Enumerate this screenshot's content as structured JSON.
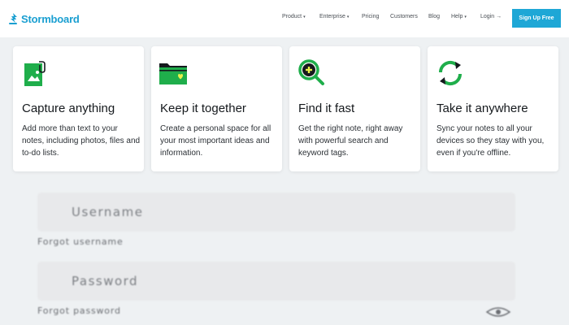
{
  "brand": {
    "name": "Stormboard",
    "color": "#1a9fd1",
    "logo_icon": "stormboard-logo-icon"
  },
  "nav": {
    "items": [
      {
        "label": "Product",
        "caret": "▾"
      },
      {
        "label": "Enterprise",
        "caret": "▾"
      },
      {
        "label": "Pricing",
        "caret": ""
      },
      {
        "label": "Customers",
        "caret": ""
      },
      {
        "label": "Blog",
        "caret": ""
      },
      {
        "label": "Help",
        "caret": "▾"
      },
      {
        "label": "Login",
        "caret": "→"
      }
    ],
    "signup_label": "Sign Up Free",
    "signup_color": "#1ea7d6"
  },
  "features": [
    {
      "icon": "image-attachment-icon",
      "title": "Capture anything",
      "description": "Add more than text to your notes, including photos, files and to-do lists."
    },
    {
      "icon": "folder-heart-icon",
      "title": "Keep it together",
      "description": "Create a personal space for all your most important ideas and information."
    },
    {
      "icon": "search-plus-icon",
      "title": "Find it fast",
      "description": "Get the right note, right away with powerful search and keyword tags."
    },
    {
      "icon": "sync-icon",
      "title": "Take it anywhere",
      "description": "Sync your notes to all your devices so they stay with you, even if you're offline."
    }
  ],
  "accent_green": "#1fae4b",
  "login": {
    "username_placeholder": "Username",
    "forgot_username": "Forgot username",
    "password_placeholder": "Password",
    "forgot_password": "Forgot password",
    "show_password_icon": "eye-icon"
  }
}
